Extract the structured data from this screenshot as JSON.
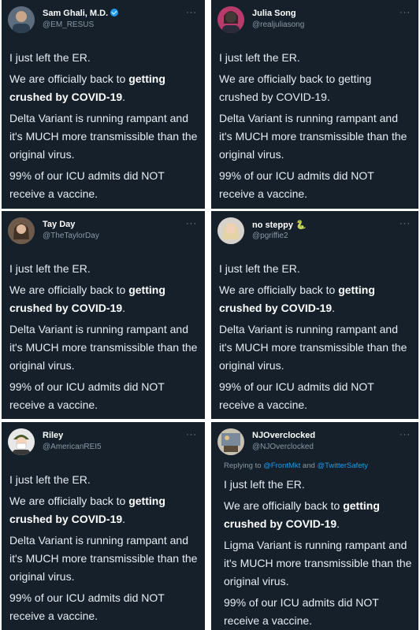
{
  "tweets": [
    {
      "name": "Sam Ghali, M.D.",
      "handle": "@EM_RESUS",
      "verified": true,
      "lines": {
        "l1": "I just left the ER.",
        "l2a": "We are officially back to ",
        "l2b": "getting crushed by COVID-19",
        "l2c": ".",
        "l3": "Delta Variant is running rampant and it's MUCH more transmissible than the original virus.",
        "l4": "99% of our ICU admits did NOT receive a vaccine."
      }
    },
    {
      "name": "Julia Song",
      "handle": "@realjuliasong",
      "lines": {
        "l1": "I just left the ER.",
        "l2": "We are officially back to getting crushed by COVID-19.",
        "l3": "Delta Variant is running rampant and it's MUCH more transmissible than the original virus.",
        "l4": "99% of our ICU admits did NOT receive a vaccine."
      }
    },
    {
      "name": "Tay Day",
      "handle": "@TheTaylorDay",
      "lines": {
        "l1": "I just left the ER.",
        "l2a": "We are officially back to ",
        "l2b": "getting crushed by COVID-19",
        "l2c": ".",
        "l3": "Delta Variant is running rampant and it's MUCH more transmissible than the original virus.",
        "l4": "99% of our ICU admits did NOT receive a vaccine."
      }
    },
    {
      "name": "no steppy",
      "handle": "@pgriffie2",
      "emoji": "🐍",
      "lines": {
        "l1": "I just left the ER.",
        "l2a": "We are officially back to ",
        "l2b": "getting crushed by COVID-19",
        "l2c": ".",
        "l3": "Delta Variant is running rampant and it's MUCH more transmissible than the original virus.",
        "l4": "99% of our ICU admits did NOT receive a vaccine."
      }
    },
    {
      "name": "Riley",
      "handle": "@AmericanREI5",
      "lines": {
        "l1": "I just left the ER.",
        "l2a": "We are officially back to ",
        "l2b": "getting crushed by COVID-19",
        "l2c": ".",
        "l3": "Delta Variant is running rampant and it's MUCH more transmissible than the original virus.",
        "l4": "99% of our ICU admits did NOT receive a vaccine."
      }
    },
    {
      "name": "NJOverclocked",
      "handle": "@NJOverclocked",
      "reply_prefix": "Replying to ",
      "reply_user1": "@FrontMkt",
      "reply_and": " and ",
      "reply_user2": "@TwitterSafety",
      "lines": {
        "l1": "I just left the ER.",
        "l2a": "We are officially back to ",
        "l2b": "getting crushed by COVID-19",
        "l2c": ".",
        "l3": "Ligma Variant is running rampant and it's MUCH more transmissible than the original virus.",
        "l4": "99% of our ICU admits did NOT receive a vaccine."
      }
    }
  ],
  "more_icon": "···"
}
